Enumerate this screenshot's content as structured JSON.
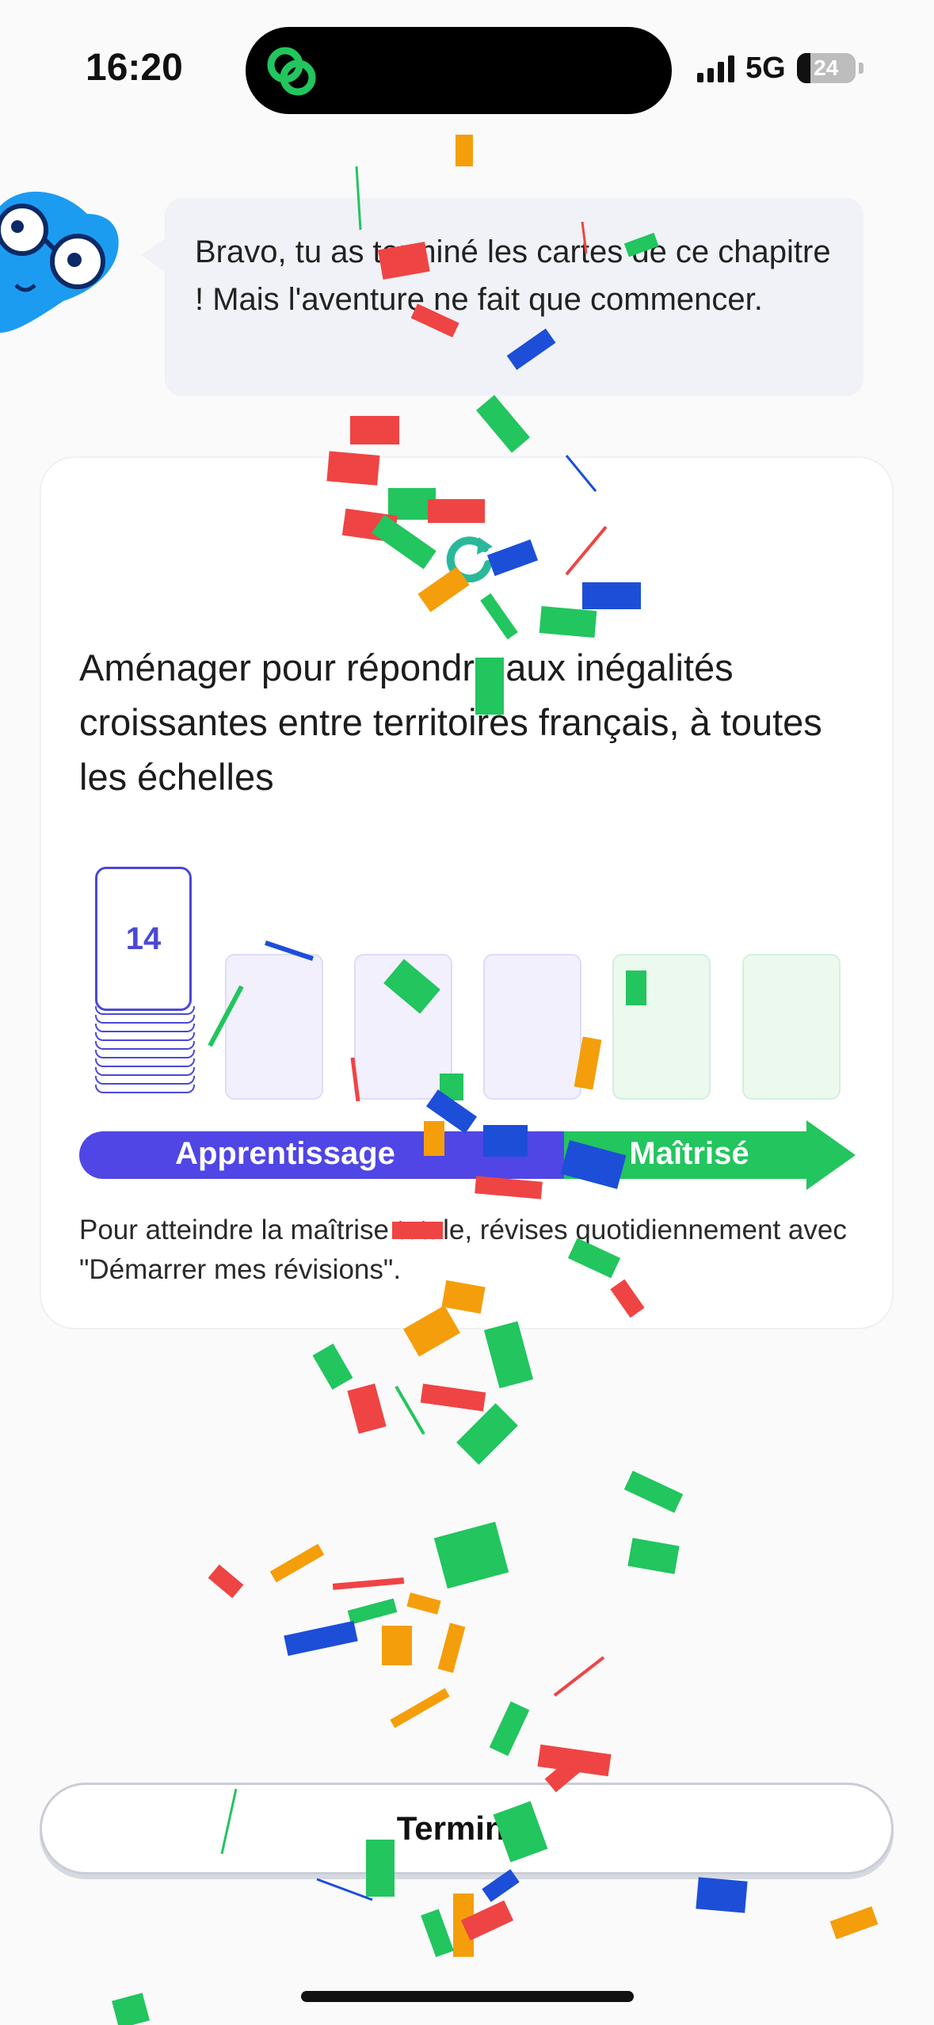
{
  "status_bar": {
    "time": "16:20",
    "network": "5G",
    "battery": "24",
    "battery_level": 0.24
  },
  "island": {
    "app_icon": "link-logo-icon"
  },
  "mascot": {
    "icon": "blue-mascot-with-glasses"
  },
  "speech_bubble": {
    "text": "Bravo, tu as terminé les cartes de ce chapitre ! Mais l'aventure ne fait que commencer."
  },
  "chapter": {
    "icon": "refresh-icon",
    "title": "Aménager pour répondre aux inégalités croissantes entre territoires français, à toutes les échelles"
  },
  "progress": {
    "learning_count": "14",
    "boxes": [
      "learning",
      "learning",
      "learning",
      "mastered",
      "mastered"
    ],
    "learning_label": "Apprentissage",
    "mastered_label": "Maîtrisé",
    "hint": "Pour atteindre la maîtrise totale, révises quotidiennement avec \"Démarrer mes révisions\"."
  },
  "footer": {
    "finish_label": "Terminer"
  },
  "colors": {
    "learning": "#5046e5",
    "mastered": "#22c55e",
    "confetti": [
      "#22c55e",
      "#ef4444",
      "#1d4ed8",
      "#f59e0b"
    ]
  }
}
